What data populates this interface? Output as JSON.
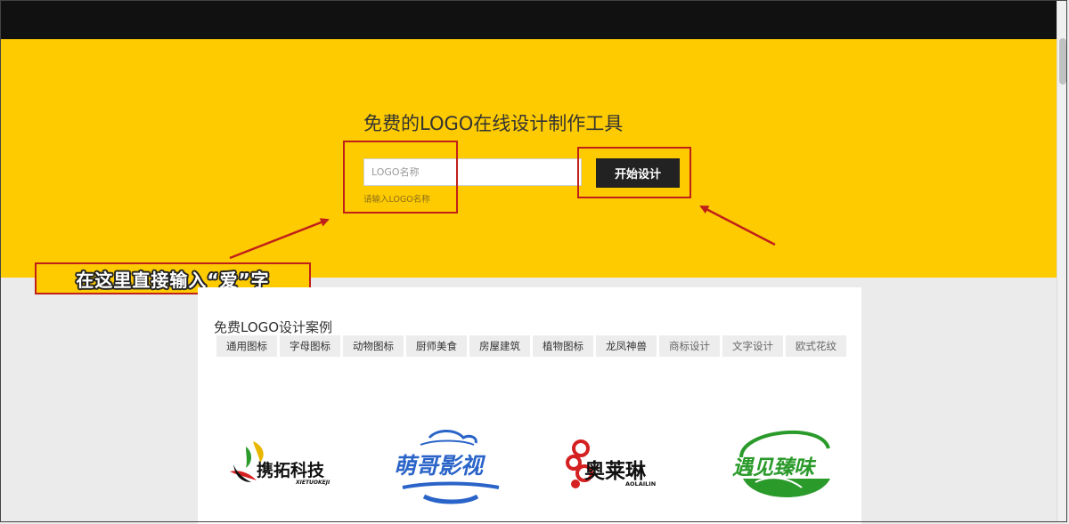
{
  "hero": {
    "title": "免费的LOGO在线设计制作工具",
    "input_placeholder": "LOGO名称",
    "input_hint": "请输入LOGO名称",
    "start_button_label": "开始设计",
    "background_color": "#fecb00"
  },
  "annotation": {
    "callout_text": "在这里直接输入“爱”字",
    "highlight_color": "#c0201a"
  },
  "cases": {
    "title": "免费LOGO设计案例",
    "tabs": [
      "通用图标",
      "字母图标",
      "动物图标",
      "厨师美食",
      "房屋建筑",
      "植物图标",
      "龙凤神兽",
      "商标设计",
      "文字设计",
      "欧式花纹"
    ],
    "logos": [
      {
        "name": "携拓科技",
        "subtitle": "XIETUOKEJI",
        "icon": "phoenix-swoosh-icon"
      },
      {
        "name": "萌哥影视",
        "subtitle": "",
        "icon": "cloud-wave-icon"
      },
      {
        "name": "奥莱琳",
        "subtitle": "AOLAILIN",
        "icon": "auspicious-cloud-icon"
      },
      {
        "name": "遇见臻味",
        "subtitle": "",
        "icon": "green-arc-leaf-icon"
      }
    ]
  }
}
